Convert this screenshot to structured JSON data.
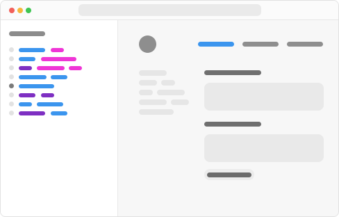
{
  "window": {
    "controls": [
      "close",
      "minimize",
      "zoom"
    ],
    "colors": {
      "close": "#f2605a",
      "minimize": "#f6b73c",
      "zoom": "#3fc552"
    }
  },
  "address_bar": {
    "value": ""
  },
  "sidebar": {
    "title": "",
    "rows": [
      {
        "active": false,
        "segments": [
          {
            "color": "#3b95ee"
          },
          {
            "color": "#ef35d6"
          }
        ]
      },
      {
        "active": false,
        "segments": [
          {
            "color": "#3b95ee"
          },
          {
            "color": "#ef35d6"
          }
        ]
      },
      {
        "active": false,
        "segments": [
          {
            "color": "#7e2fc2"
          },
          {
            "color": "#ef35d6"
          },
          {
            "color": "#ef35d6"
          }
        ]
      },
      {
        "active": false,
        "segments": [
          {
            "color": "#3b95ee"
          },
          {
            "color": "#3b95ee"
          }
        ]
      },
      {
        "active": true,
        "segments": [
          {
            "color": "#3b95ee"
          }
        ]
      },
      {
        "active": false,
        "segments": [
          {
            "color": "#7e2fc2"
          },
          {
            "color": "#7e2fc2"
          }
        ]
      },
      {
        "active": false,
        "segments": [
          {
            "color": "#3b95ee"
          },
          {
            "color": "#3b95ee"
          }
        ]
      },
      {
        "active": false,
        "segments": [
          {
            "color": "#7e2fc2"
          },
          {
            "color": "#3b95ee"
          }
        ]
      }
    ]
  },
  "main": {
    "tabs": [
      {
        "label": "",
        "selected": true,
        "color": "#3b95ee"
      },
      {
        "label": "",
        "selected": false,
        "color": "#8e8e8e"
      },
      {
        "label": "",
        "selected": false,
        "color": "#8e8e8e"
      }
    ],
    "sections": [
      {
        "heading": "",
        "body": ""
      },
      {
        "heading": "",
        "body": ""
      }
    ],
    "action_button": {
      "label": ""
    }
  }
}
